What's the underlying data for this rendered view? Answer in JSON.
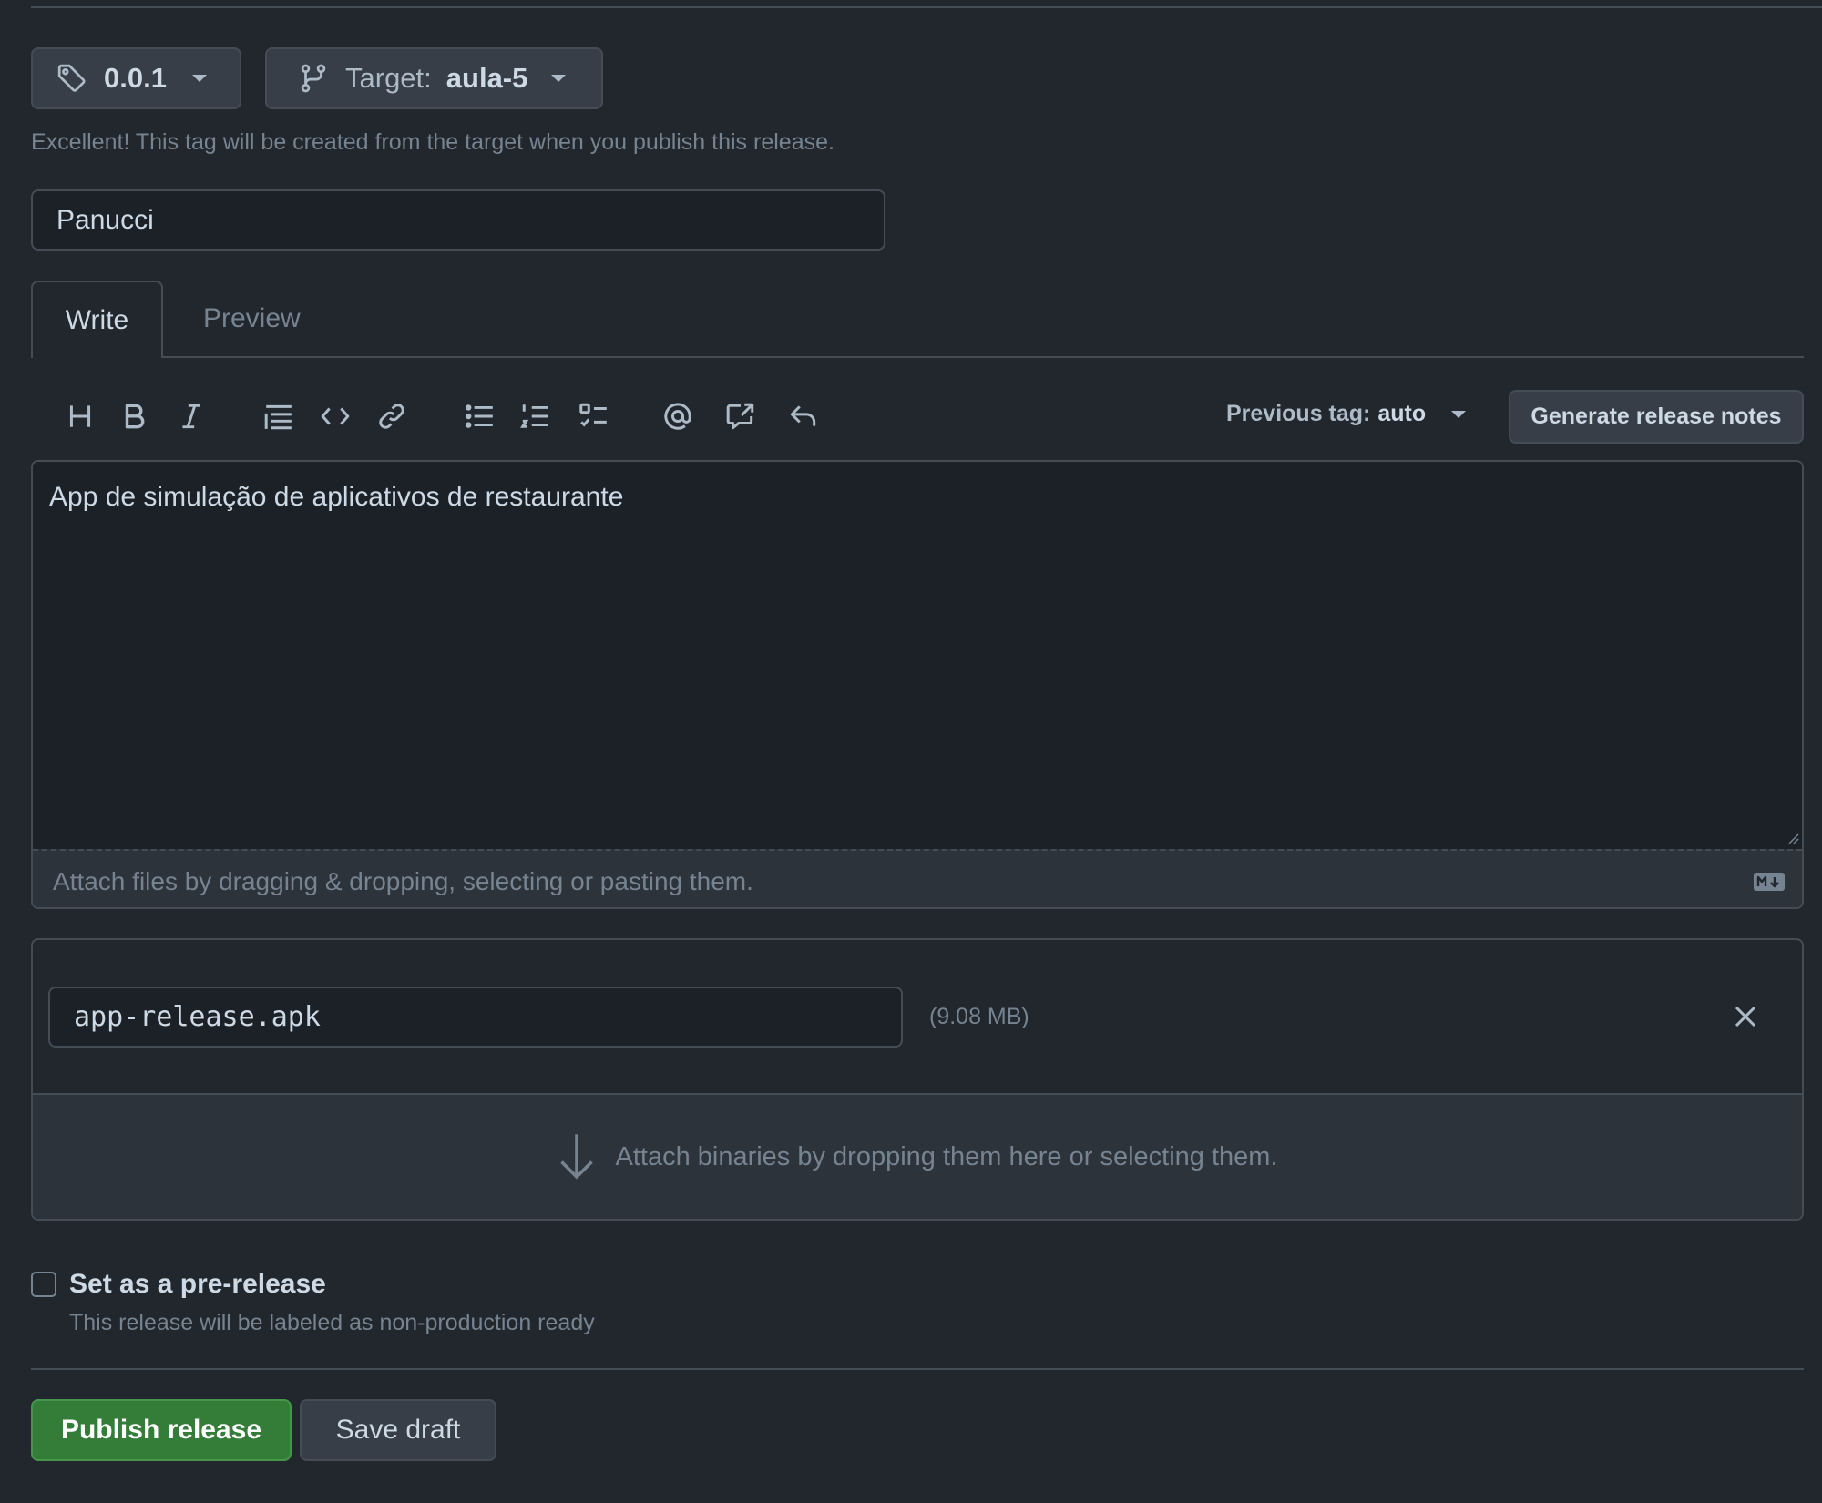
{
  "release": {
    "tag": "0.0.1",
    "target_label": "Target:",
    "target_value": "aula-5",
    "tag_hint": "Excellent! This tag will be created from the target when you publish this release.",
    "title_value": "Panucci"
  },
  "editor": {
    "tabs": [
      {
        "label": "Write",
        "active": true
      },
      {
        "label": "Preview",
        "active": false
      }
    ],
    "toolbar_icons": [
      "heading-icon",
      "bold-icon",
      "italic-icon",
      "quote-icon",
      "code-icon",
      "link-icon",
      "unordered-list-icon",
      "ordered-list-icon",
      "task-list-icon",
      "mention-icon",
      "cross-reference-icon",
      "reply-icon"
    ],
    "previous_tag_label": "Previous tag:",
    "previous_tag_value": "auto",
    "generate_notes_label": "Generate release notes",
    "body_text": "App de simulação de aplicativos de restaurante",
    "attach_hint": "Attach files by dragging & dropping, selecting or pasting them."
  },
  "binaries": {
    "files": [
      {
        "name": "app-release.apk",
        "size": "(9.08 MB)"
      }
    ],
    "drop_hint": "Attach binaries by dropping them here or selecting them."
  },
  "prerelease": {
    "checked": false,
    "label": "Set as a pre-release",
    "description": "This release will be labeled as non-production ready"
  },
  "actions": {
    "publish_label": "Publish release",
    "save_draft_label": "Save draft"
  },
  "colors": {
    "background": "#22272e",
    "publish_green": "#347d39"
  }
}
